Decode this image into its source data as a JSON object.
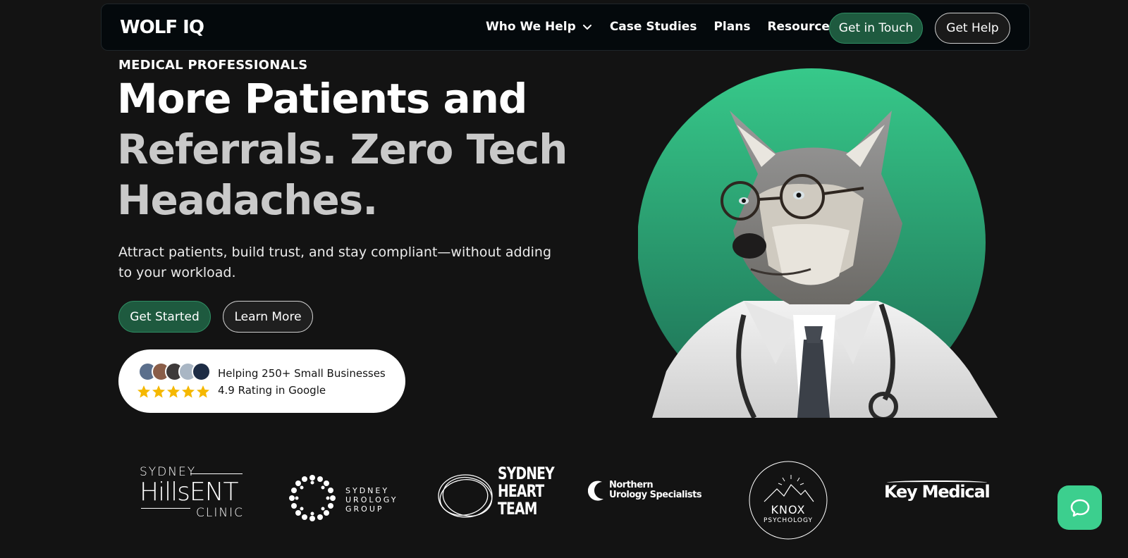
{
  "nav": {
    "logo": "WOLF IQ",
    "links": [
      "Who We Help",
      "Case Studies",
      "Plans",
      "Resources"
    ],
    "get_in_touch": "Get in Touch",
    "get_help": "Get Help"
  },
  "hero": {
    "eyebrow": "MEDICAL PROFESSIONALS",
    "title_line1": "More Patients and",
    "title_line2": "Referrals. Zero Tech",
    "title_line3": "Headaches.",
    "subtitle": "Attract patients, build trust, and stay compliant—without adding to your workload.",
    "primary_cta": "Get Started",
    "secondary_cta": "Learn More"
  },
  "trust": {
    "line1": "Helping 250+ Small Businesses",
    "line2": "4.9 Rating in Google",
    "rating": 5
  },
  "clients": {
    "sydney_hills_ent": {
      "top": "SYDNEY",
      "mid": "HillsENT",
      "bottom": "CLINIC"
    },
    "sydney_urology": {
      "l1": "SYDNEY",
      "l2": "UROLOGY",
      "l3": "GROUP"
    },
    "sydney_heart": {
      "l1": "SYDNEY",
      "l2": "HEART",
      "l3": "TEAM"
    },
    "northern_urology": {
      "l1": "Northern",
      "l2": "Urology Specialists"
    },
    "knox": {
      "l1": "KNOX",
      "l2": "PSYCHOLOGY"
    },
    "key_medical": "Key Medical"
  },
  "colors": {
    "background": "#131313",
    "brand_green": "#1e5a3f",
    "accent_green": "#3ccf8e",
    "star_yellow": "#f5b800"
  },
  "icons": {
    "nav_dropdown": "chevron-down-icon",
    "chat": "chat-icon"
  }
}
